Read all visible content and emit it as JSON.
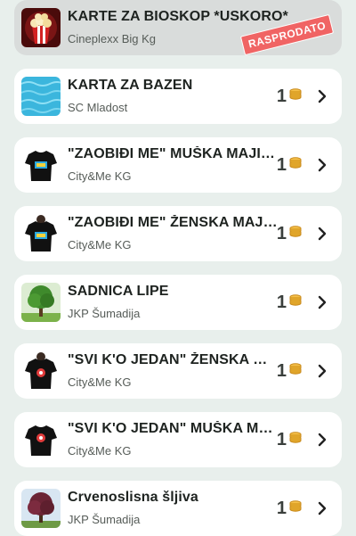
{
  "products": [
    {
      "title": "KARTE ZA BIOSKOP *USKORO*",
      "vendor": "Cineplexx Big Kg",
      "price": "",
      "sold_out": true,
      "badge": "RASPRODATO",
      "thumb": "popcorn-thumbnail"
    },
    {
      "title": "KARTA ZA BAZEN",
      "vendor": "SC Mladost",
      "price": "1",
      "thumb": "pool-water-thumbnail"
    },
    {
      "title": "\"ZAOBIĐI ME\" MUŠKA MAJICA",
      "vendor": "City&Me KG",
      "price": "1",
      "thumb": "tshirt-thumbnail"
    },
    {
      "title": "\"ZAOBIĐI ME\" ŽENSKA MAJICA",
      "vendor": "City&Me KG",
      "price": "1",
      "thumb": "tshirt-thumbnail"
    },
    {
      "title": "SADNICA LIPE",
      "vendor": "JKP Šumadija",
      "price": "1",
      "thumb": "linden-tree-thumbnail"
    },
    {
      "title": "\"SVI K'O JEDAN\" ŽENSKA MA…",
      "vendor": "City&Me KG",
      "price": "1",
      "thumb": "tshirt-thumbnail"
    },
    {
      "title": "\"SVI K'O JEDAN\" MUŠKA MAJ…",
      "vendor": "City&Me KG",
      "price": "1",
      "thumb": "tshirt-thumbnail"
    },
    {
      "title": "Crvenoslisna šljiva",
      "vendor": "JKP Šumadija",
      "price": "1",
      "thumb": "plum-tree-thumbnail"
    }
  ],
  "icons": {
    "coin": "coin-stack-icon",
    "chevron": "chevron-right-icon"
  },
  "colors": {
    "background": "#e8efec",
    "card": "#ffffff",
    "sold_card": "#d9dcdb",
    "badge": "#f06464",
    "coin": "#e0a52a"
  }
}
